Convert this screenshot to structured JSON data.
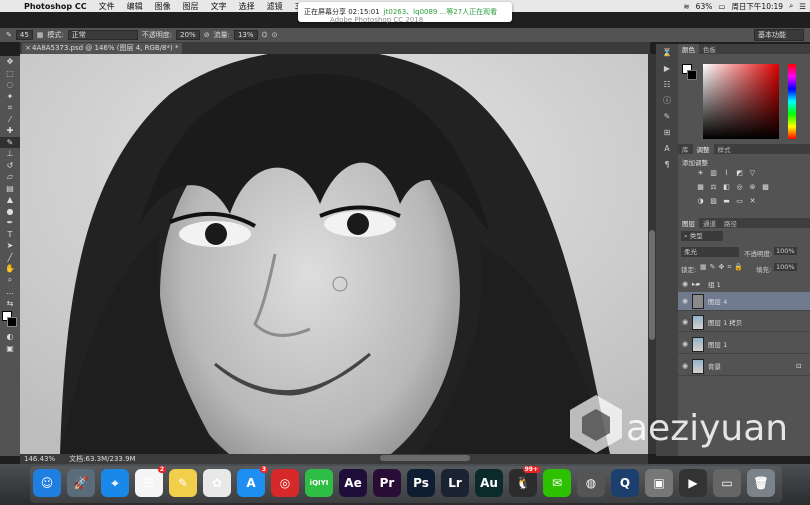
{
  "menubar": {
    "app": "Photoshop CC",
    "items": [
      "文件",
      "编辑",
      "图像",
      "图层",
      "文字",
      "选择",
      "滤镜",
      "3D"
    ],
    "status": {
      "battery": "63%",
      "datetime": "周日下午10:19"
    }
  },
  "share": {
    "label": "正在屏幕分享 02:15:01",
    "viewers": "jt0263、lq0089 ...等27人正在观看"
  },
  "window_title": "Adobe Photoshop CC 2018",
  "options": {
    "brush_size": "45",
    "mode_label": "模式:",
    "mode_value": "正常",
    "opacity_label": "不透明度:",
    "opacity_value": "20%",
    "flow_label": "流量:",
    "flow_value": "13%",
    "workspace": "基本功能"
  },
  "document": {
    "tab_title": "4A8A5373.psd @ 146% (图层 4, RGB/8*) *",
    "zoom": "146.43%",
    "doc_size": "文档:63.3M/233.9M"
  },
  "panels": {
    "color_tabs": [
      "颜色",
      "色板"
    ],
    "adjust_tabs": [
      "库",
      "调整",
      "样式"
    ],
    "adjust_title": "添加调整",
    "layer_tabs": [
      "图层",
      "通道",
      "路径"
    ],
    "kind_filter": "类型",
    "blend_mode": "柔光",
    "layer_opacity_label": "不透明度:",
    "layer_opacity": "100%",
    "lock_label": "锁定:",
    "fill_label": "填充:",
    "fill": "100%"
  },
  "layers": [
    {
      "name": "组 1",
      "type": "group"
    },
    {
      "name": "图层 4",
      "type": "layer",
      "selected": true
    },
    {
      "name": "图层 1 拷贝",
      "type": "photo"
    },
    {
      "name": "图层 1",
      "type": "photo"
    },
    {
      "name": "背景",
      "type": "photo",
      "locked": true
    }
  ],
  "dock": [
    {
      "name": "finder",
      "label": "☺",
      "color": "#1e7fe0"
    },
    {
      "name": "launchpad",
      "label": "🚀",
      "color": "#5a6b7a"
    },
    {
      "name": "safari",
      "label": "⌖",
      "color": "#1a88e8"
    },
    {
      "name": "reminders",
      "label": "☰",
      "color": "#f5f5f5",
      "badge": "2"
    },
    {
      "name": "notes",
      "label": "✎",
      "color": "#f2cf4a"
    },
    {
      "name": "photos",
      "label": "✿",
      "color": "#e8e8e8"
    },
    {
      "name": "app-store",
      "label": "A",
      "color": "#1e8ef0",
      "badge": "3"
    },
    {
      "name": "netease-music",
      "label": "◎",
      "color": "#d7282a"
    },
    {
      "name": "iqiyi",
      "label": "iQIYI",
      "color": "#2ebd45"
    },
    {
      "name": "after-effects",
      "label": "Ae",
      "color": "#1f0e3a"
    },
    {
      "name": "premiere",
      "label": "Pr",
      "color": "#2a0d36"
    },
    {
      "name": "photoshop",
      "label": "Ps",
      "color": "#0f1d33"
    },
    {
      "name": "lightroom",
      "label": "Lr",
      "color": "#1b2232"
    },
    {
      "name": "audition",
      "label": "Au",
      "color": "#0b2a2a"
    },
    {
      "name": "qq",
      "label": "🐧",
      "color": "#2c2c2c",
      "badge": "99+"
    },
    {
      "name": "wechat",
      "label": "✉",
      "color": "#2dc100"
    },
    {
      "name": "screenshot",
      "label": "◍",
      "color": "#555"
    },
    {
      "name": "quicktime",
      "label": "Q",
      "color": "#1c3f6e"
    },
    {
      "name": "photo-viewer",
      "label": "▣",
      "color": "#777"
    },
    {
      "name": "screen-record",
      "label": "▶",
      "color": "#333"
    },
    {
      "name": "presentation",
      "label": "▭",
      "color": "#666"
    },
    {
      "name": "trash",
      "label": "🗑",
      "color": "#7b8288"
    }
  ],
  "watermark": "aeziyuan"
}
